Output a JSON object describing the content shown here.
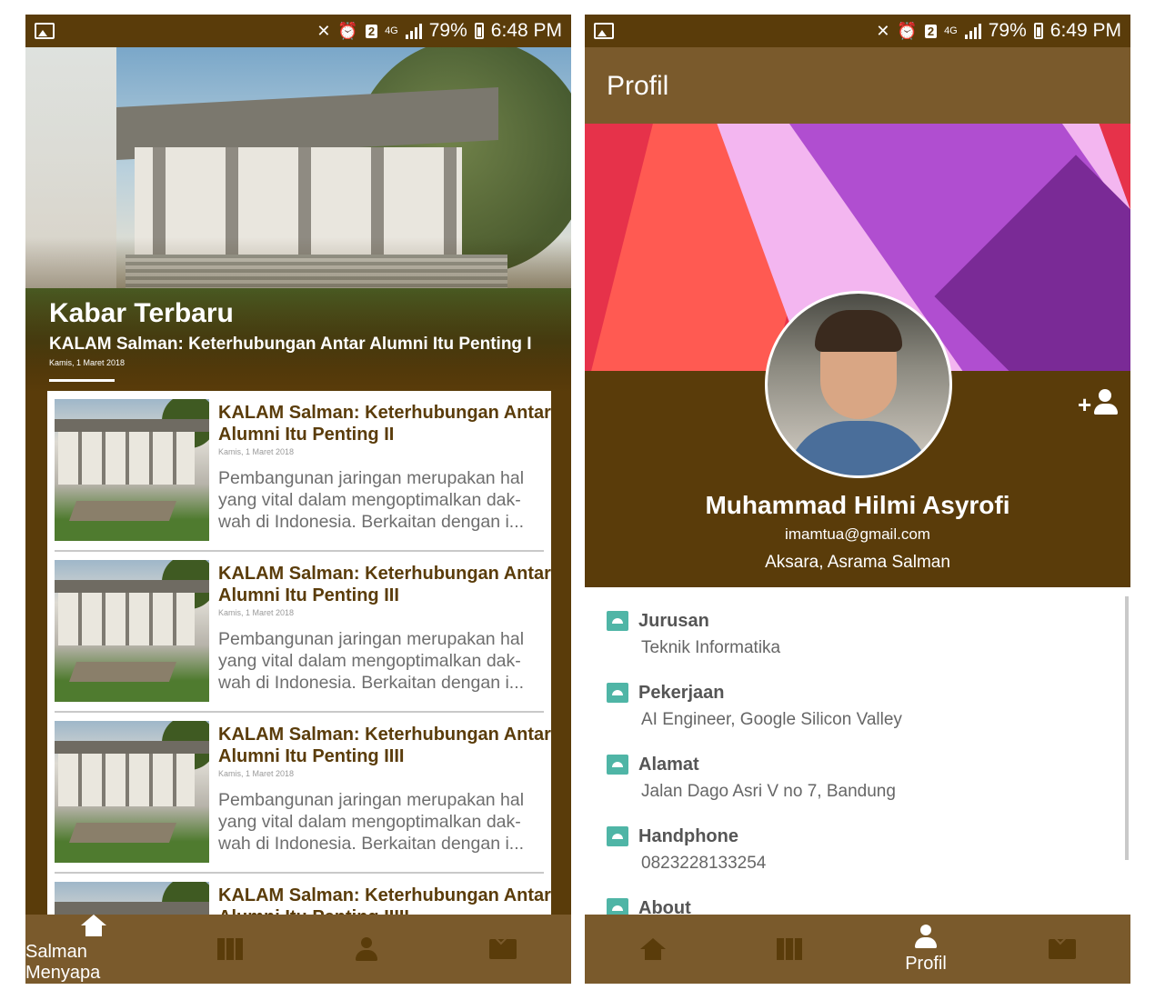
{
  "left": {
    "statusbar": {
      "battery": "79%",
      "time": "6:48 PM",
      "network": "4G",
      "sim": "2"
    },
    "hero": {
      "title": "Kabar Terbaru",
      "subtitle": "KALAM Salman: Keterhubungan Antar Alumni Itu Penting I",
      "date": "Kamis, 1 Maret 2018"
    },
    "news": [
      {
        "title": "KALAM Salman: Keterhubungan Antar Alumni Itu Penting II",
        "date": "Kamis, 1 Maret 2018",
        "excerpt": "Pembangunan jaringan merupakan hal yang vital dalam mengoptimalkan dak-wah di Indonesia. Berkaitan dengan i..."
      },
      {
        "title": "KALAM Salman: Keterhubungan Antar Alumni Itu Penting III",
        "date": "Kamis, 1 Maret 2018",
        "excerpt": "Pembangunan jaringan merupakan hal yang vital dalam mengoptimalkan dak-wah di Indonesia. Berkaitan dengan i..."
      },
      {
        "title": "KALAM Salman: Keterhubungan Antar Alumni Itu Penting IIII",
        "date": "Kamis, 1 Maret 2018",
        "excerpt": "Pembangunan jaringan merupakan hal yang vital dalam mengoptimalkan dak-wah di Indonesia. Berkaitan dengan i..."
      },
      {
        "title": "KALAM Salman: Keterhubungan Antar Alumni Itu Penting IIIII",
        "date": "",
        "excerpt": ""
      }
    ],
    "nav": {
      "active_label": "Salman Menyapa"
    }
  },
  "right": {
    "statusbar": {
      "battery": "79%",
      "time": "6:49 PM",
      "network": "4G",
      "sim": "2"
    },
    "appbar_title": "Profil",
    "profile": {
      "name": "Muhammad Hilmi Asyrofi",
      "email": "imamtua@gmail.com",
      "affiliation": "Aksara, Asrama Salman"
    },
    "details": [
      {
        "label": "Jurusan",
        "value": "Teknik Informatika"
      },
      {
        "label": "Pekerjaan",
        "value": "AI Engineer, Google Silicon Valley"
      },
      {
        "label": "Alamat",
        "value": "Jalan Dago Asri V no 7, Bandung"
      },
      {
        "label": "Handphone",
        "value": "0823228133254"
      },
      {
        "label": "About",
        "value": ""
      }
    ],
    "nav": {
      "active_label": "Profil"
    }
  },
  "colors": {
    "brown_dark": "#5a3c0a",
    "brown_bar": "#7a5a2c",
    "title_brown": "#5a3c0a",
    "teal_icon": "#4fb5a6"
  }
}
